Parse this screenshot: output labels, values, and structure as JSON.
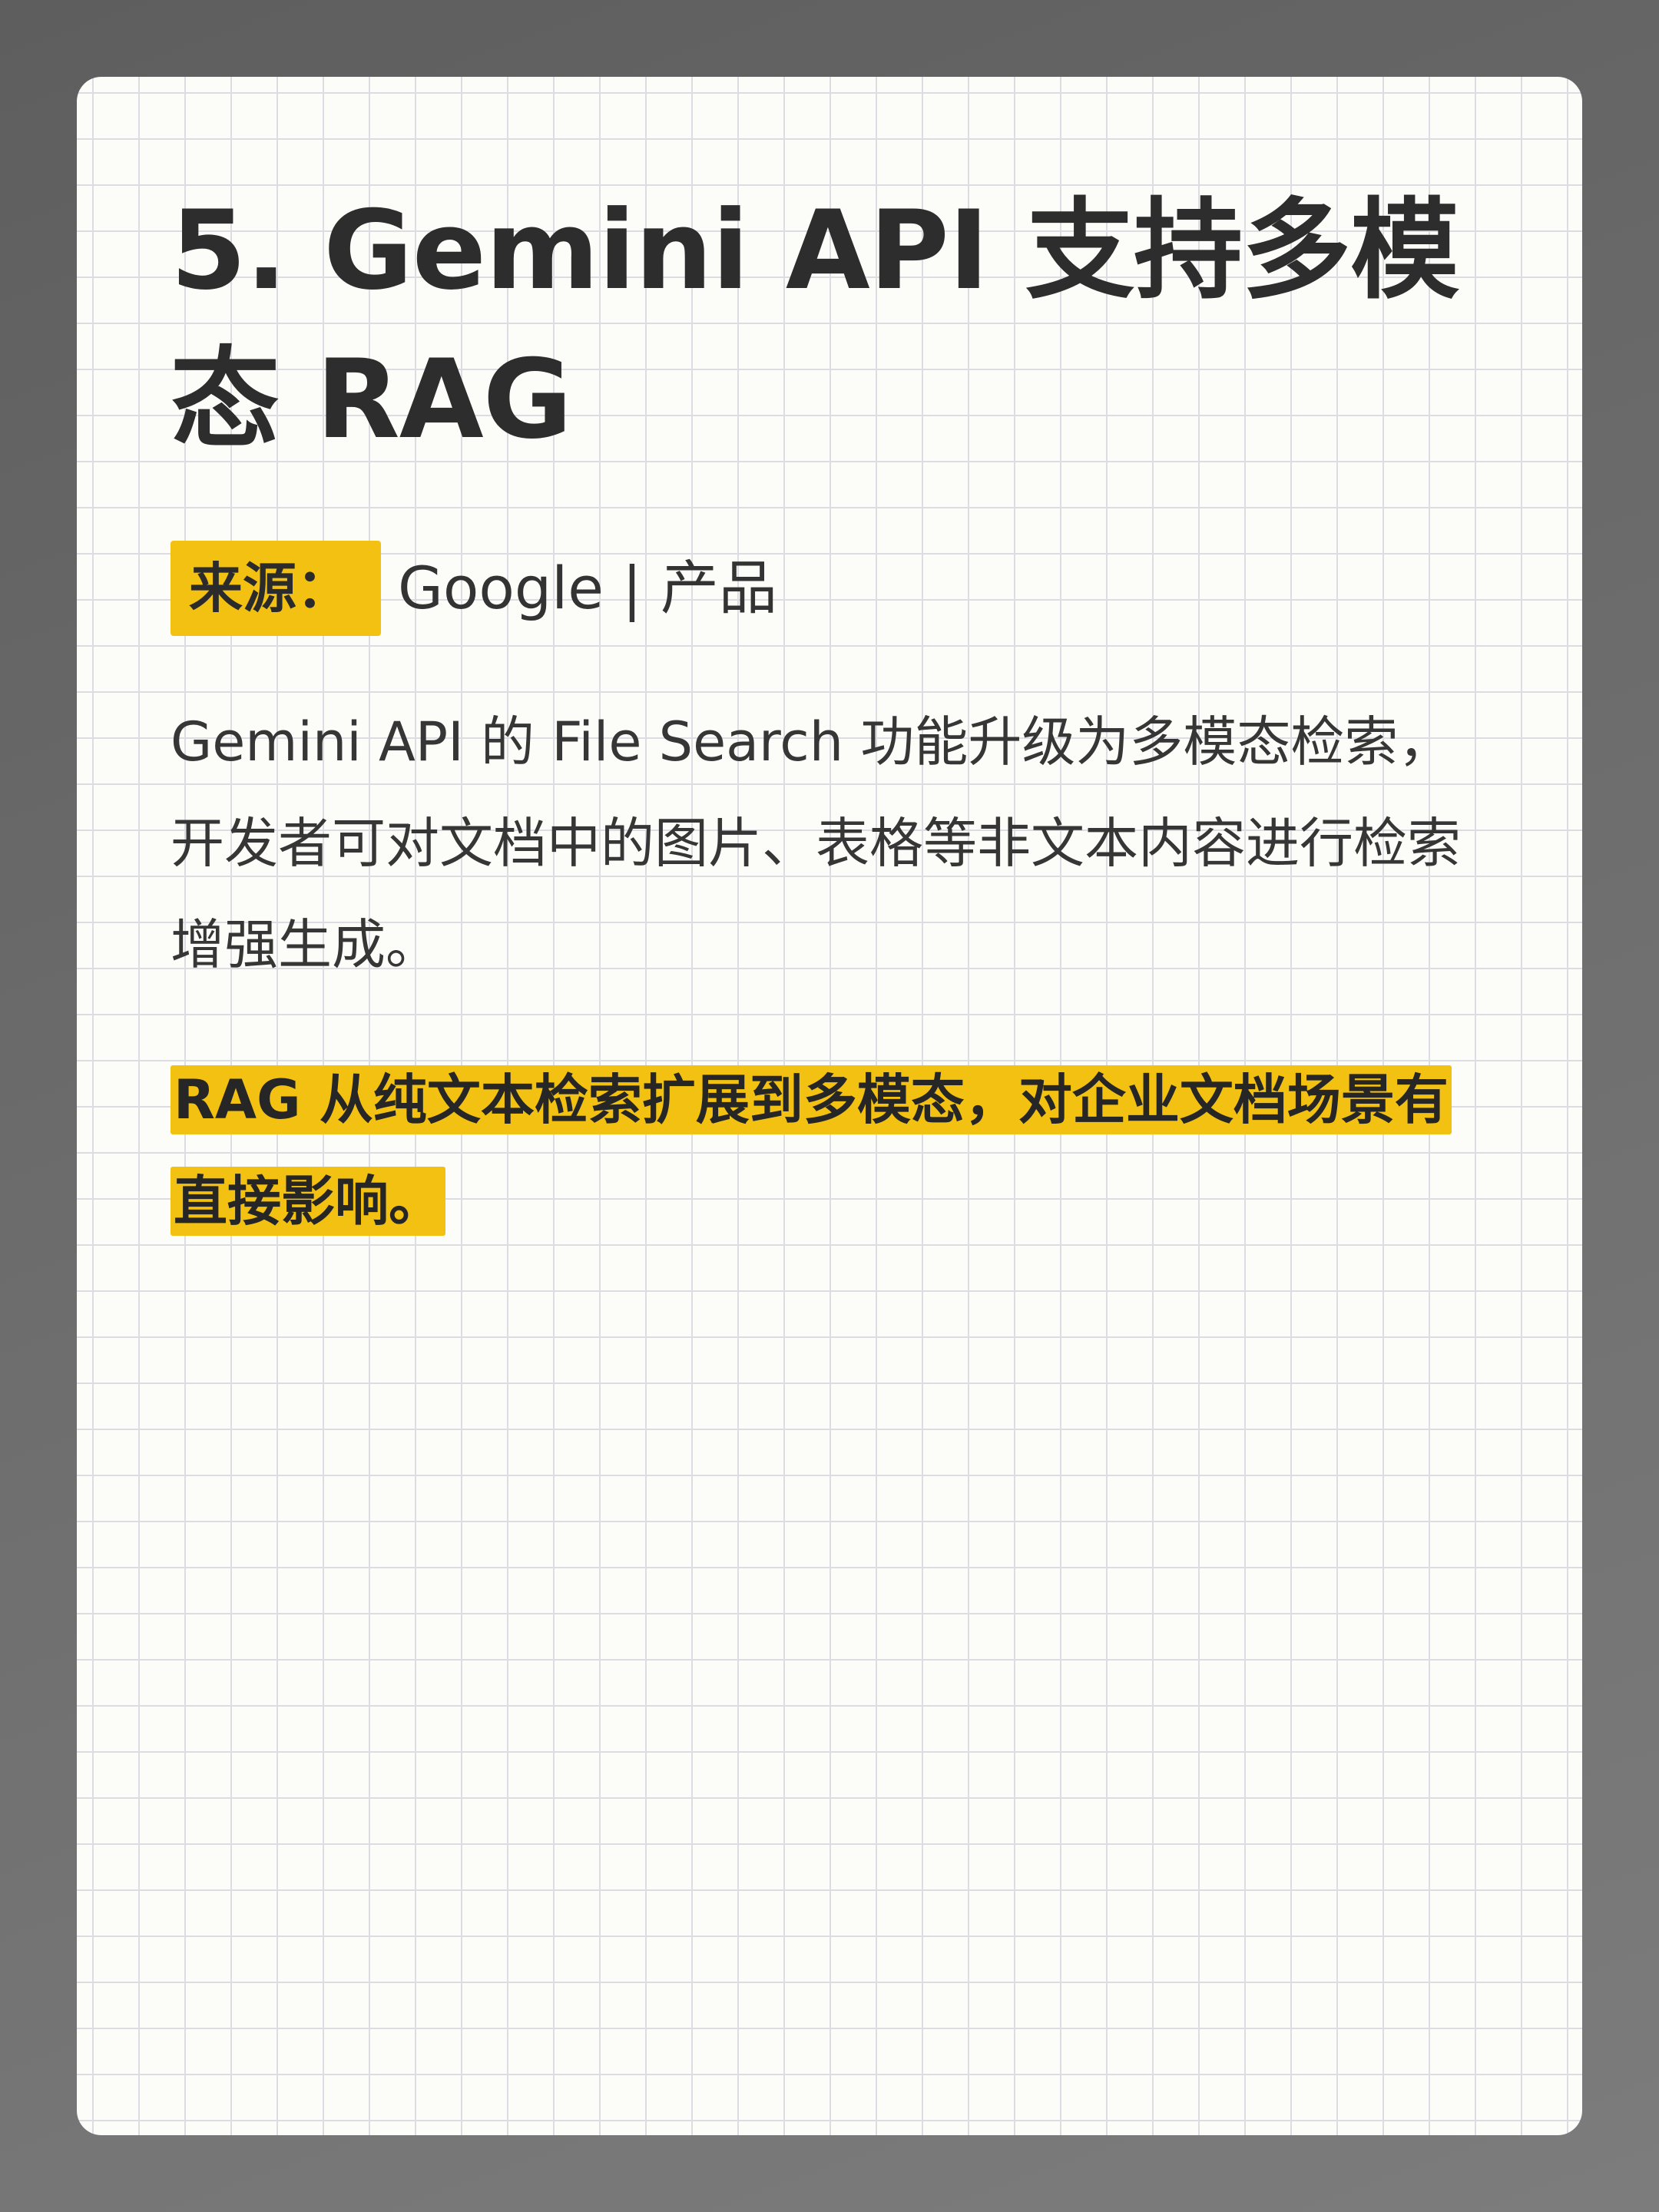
{
  "card": {
    "title": "5. Gemini API 支持多模态 RAG",
    "source_label": "来源：",
    "source_value": "Google | 产品",
    "description": "Gemini API 的 File Search 功能升级为多模态检索，开发者可对文档中的图片、表格等非文本内容进行检索增强生成。",
    "highlight": "RAG 从纯文本检索扩展到多模态，对企业文档场景有直接影响。"
  },
  "colors": {
    "highlight": "#f2c111",
    "text": "#2d2d2d",
    "card_background": "#fcfcf8",
    "grid_line": "#dcdde2"
  }
}
